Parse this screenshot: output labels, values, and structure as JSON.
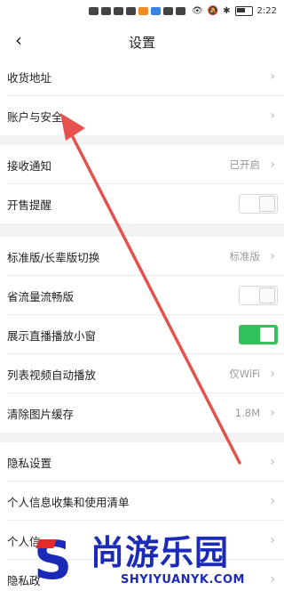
{
  "status_bar": {
    "time": "2:22",
    "battery_icon": "battery-icon"
  },
  "header": {
    "title": "设置",
    "back_glyph": "‹"
  },
  "sections": [
    [
      {
        "label": "收货地址",
        "control": "chevron"
      },
      {
        "label": "账户与安全",
        "control": "chevron"
      }
    ],
    [
      {
        "label": "接收通知",
        "value": "已开启",
        "control": "chevron"
      },
      {
        "label": "开售提醒",
        "control": "toggle",
        "toggle_on": false
      }
    ],
    [
      {
        "label": "标准版/长辈版切换",
        "value": "标准版",
        "control": "chevron"
      },
      {
        "label": "省流量流畅版",
        "control": "toggle",
        "toggle_on": false
      },
      {
        "label": "展示直播播放小窗",
        "control": "toggle",
        "toggle_on": true
      },
      {
        "label": "列表视频自动播放",
        "value": "仅WiFi",
        "control": "chevron"
      },
      {
        "label": "清除图片缓存",
        "value": "1.8M",
        "control": "chevron"
      }
    ],
    [
      {
        "label": "隐私设置",
        "control": "chevron"
      },
      {
        "label": "个人信息收集和使用清单",
        "control": "chevron"
      },
      {
        "label": "个人信",
        "control": "chevron"
      },
      {
        "label": "隐私政",
        "control": "chevron"
      }
    ]
  ],
  "watermark": {
    "text": "尚游乐园",
    "url": "SHYIYUANYK.COM",
    "color": "#1b2bb7"
  },
  "annotation": {
    "color": "#e5524e",
    "description": "red arrow pointing to 账户与安全"
  },
  "colors": {
    "toggle_on": "#33c15b",
    "background": "#f2f2f2"
  }
}
